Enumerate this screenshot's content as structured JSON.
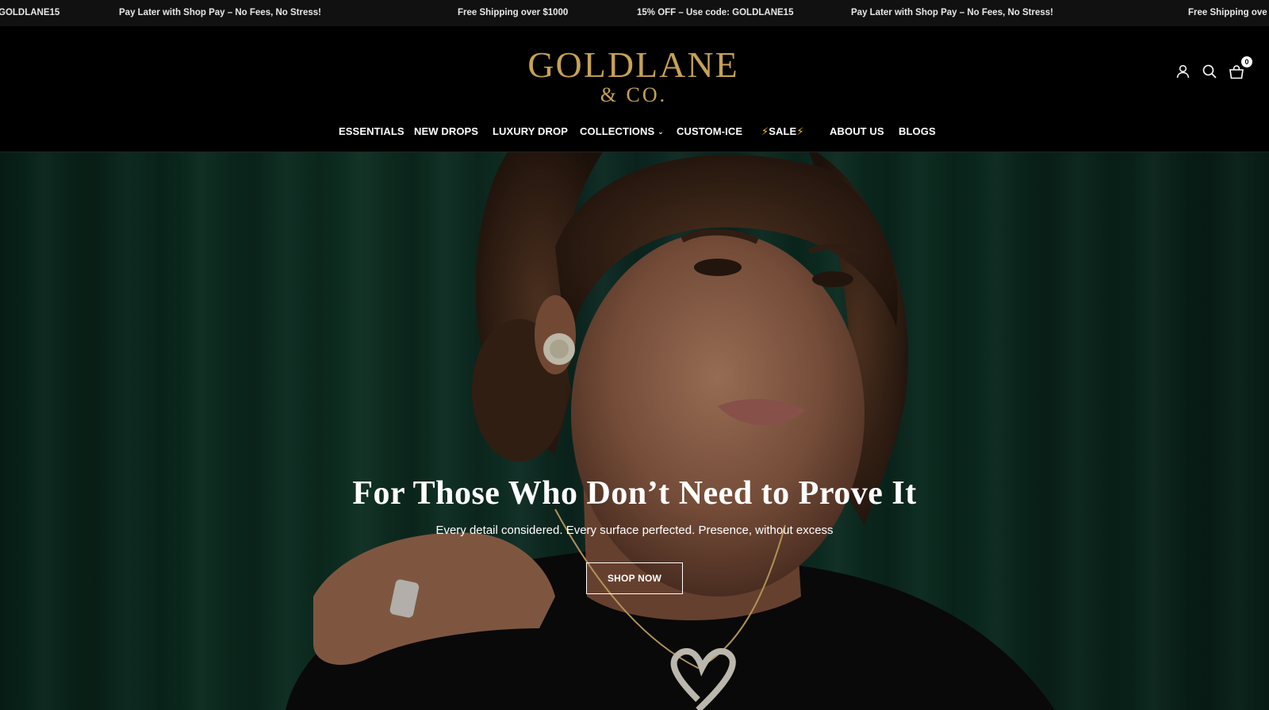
{
  "announcement": {
    "items": [
      "GOLDLANE15",
      "Pay Later with Shop Pay – No Fees, No Stress!",
      "Free Shipping over $1000",
      "15% OFF – Use code: GOLDLANE15",
      "Pay Later with Shop Pay – No Fees, No Stress!",
      "Free Shipping ove"
    ]
  },
  "header": {
    "logo_line1": "GOLDLANE",
    "logo_line2": "& CO.",
    "cart_count": "0",
    "icons": [
      "account-icon",
      "search-icon",
      "cart-icon"
    ]
  },
  "nav": {
    "items": [
      {
        "label": "ESSENTIALS"
      },
      {
        "label": "NEW DROPS"
      },
      {
        "label": "LUXURY DROP"
      },
      {
        "label": "COLLECTIONS",
        "has_dropdown": true
      },
      {
        "label": "CUSTOM-ICE"
      },
      {
        "label": "SALE",
        "prefix": "⚡",
        "suffix": "⚡"
      },
      {
        "label": "ABOUT US"
      },
      {
        "label": "BLOGS"
      }
    ],
    "dropdown_glyph": "⌄"
  },
  "hero": {
    "title": "For Those Who Don’t Need to Prove It",
    "subtitle": "Every detail considered. Every surface perfected. Presence, without excess",
    "button_label": "SHOP NOW"
  },
  "colors": {
    "brand_gold": "#c7a254",
    "background": "#000000",
    "hero_green": "#0f3527",
    "text": "#ffffff"
  }
}
